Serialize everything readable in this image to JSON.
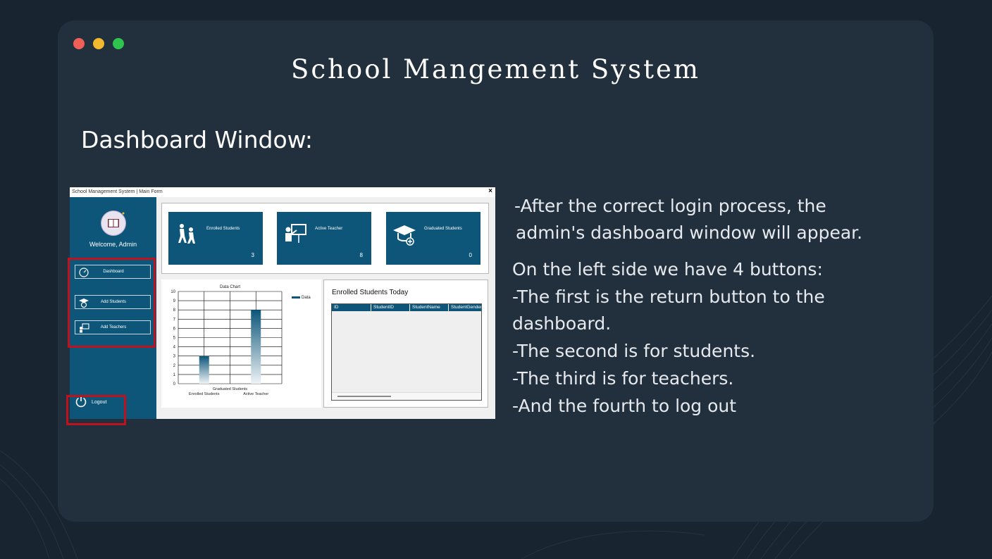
{
  "slide": {
    "title": "School Mangement System",
    "subtitle": "Dashboard Window:"
  },
  "description": {
    "lines": [
      "-After the correct login process, the",
      "admin's dashboard window will appear.",
      "On the left side we have 4 buttons:",
      "-The first is the return button to the",
      "dashboard.",
      "-The second is for students.",
      "-The third is for teachers.",
      "-And the fourth to log out"
    ]
  },
  "app": {
    "window_title": "School Management System | Main Form",
    "close_label": "×",
    "sidebar": {
      "welcome": "Welcome, Admin",
      "buttons": [
        {
          "label": "Dashboard",
          "icon": "dashboard-gauge-icon"
        },
        {
          "label": "Add Students",
          "icon": "graduate-student-icon"
        },
        {
          "label": "Add Teachers",
          "icon": "teacher-board-icon"
        }
      ],
      "logout": {
        "label": "Logout",
        "icon": "power-icon"
      }
    },
    "cards": [
      {
        "label": "Enrolled Students",
        "value": "3",
        "icon": "students-walking-icon"
      },
      {
        "label": "Active Teacher",
        "value": "8",
        "icon": "teacher-presentation-icon"
      },
      {
        "label": "Graduated Students",
        "value": "0",
        "icon": "graduation-cap-icon"
      }
    ],
    "grid": {
      "title": "Enrolled Students Today",
      "columns": [
        "ID",
        "StudentID",
        "StudentName",
        "StudentGender"
      ]
    }
  },
  "chart_data": {
    "type": "bar",
    "title": "Data Chart",
    "categories": [
      "Enrolled Students",
      "Graduated Students",
      "Active Teacher"
    ],
    "series": [
      {
        "name": "Data",
        "values": [
          3,
          0,
          8
        ]
      }
    ],
    "ylim": [
      0,
      10
    ],
    "yticks": [
      "0",
      "1",
      "2",
      "3",
      "4",
      "5",
      "6",
      "7",
      "8",
      "9",
      "10"
    ],
    "grid": true,
    "legend": "top-right",
    "colors": {
      "bar_top": "#0d5679",
      "bar_bottom": "#eef3f6"
    }
  },
  "colors": {
    "background": "#18242f",
    "slide": "#22303e",
    "app_blue": "#0d5679",
    "highlight": "#c0121d"
  }
}
